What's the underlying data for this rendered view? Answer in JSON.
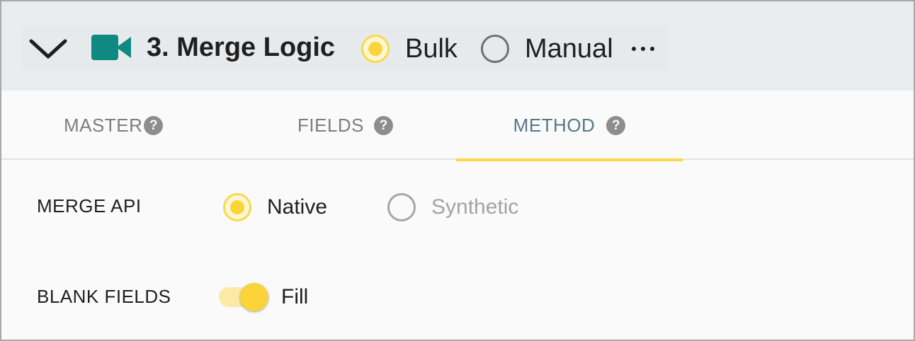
{
  "header": {
    "title": "3. Merge Logic",
    "mode_options": [
      {
        "label": "Bulk",
        "selected": true
      },
      {
        "label": "Manual",
        "selected": false
      }
    ],
    "icons": {
      "collapse": "chevron-down-icon",
      "step": "video-camera-icon",
      "more": "more-horizontal-icon"
    }
  },
  "tabs": [
    {
      "label": "MASTER",
      "active": false
    },
    {
      "label": "FIELDS",
      "active": false
    },
    {
      "label": "METHOD",
      "active": true
    }
  ],
  "help_glyph": "?",
  "merge_api": {
    "label": "MERGE API",
    "options": [
      {
        "label": "Native",
        "selected": true,
        "enabled": true
      },
      {
        "label": "Synthetic",
        "selected": false,
        "enabled": false
      }
    ]
  },
  "blank_fields": {
    "label": "BLANK FIELDS",
    "toggle_on": true,
    "toggle_label": "Fill"
  },
  "colors": {
    "accent": "#fbd43a",
    "camera_icon": "#0f8a82",
    "active_tab_text": "#5b7785",
    "header_bg": "#eaedf0"
  }
}
